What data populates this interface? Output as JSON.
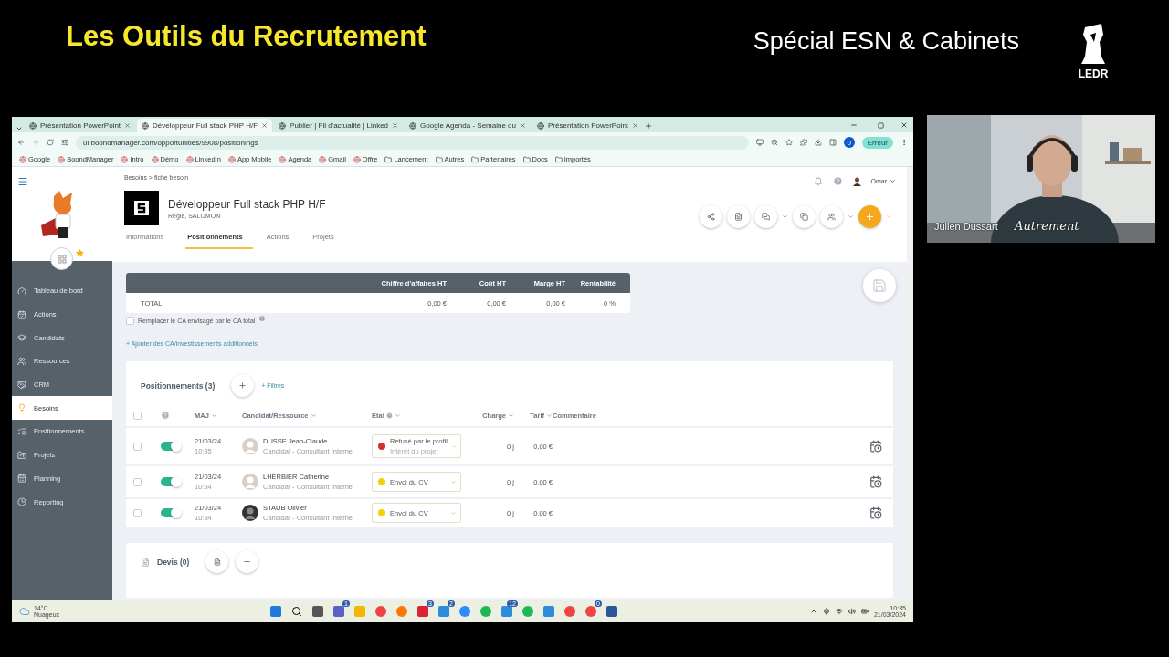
{
  "slide": {
    "title": "Les Outils du Recrutement",
    "subtitle": "Spécial ESN & Cabinets",
    "logo": "LEDR"
  },
  "browser": {
    "tabs": [
      {
        "label": "Présentation PowerPoint",
        "selected": false
      },
      {
        "label": "Développeur Full stack PHP H/F",
        "selected": true
      },
      {
        "label": "Publier | Fil d'actualité | Linked",
        "selected": false
      },
      {
        "label": "Google Agenda - Semaine du",
        "selected": false
      },
      {
        "label": "Présentation PowerPoint",
        "selected": false
      }
    ],
    "url": "ui.boondmanager.com/opportunities/9908/positionings",
    "profile": "0",
    "status_button": "Erreur",
    "bookmarks": [
      {
        "label": "Google",
        "kind": "link"
      },
      {
        "label": "BoondManager",
        "kind": "link"
      },
      {
        "label": "Intro",
        "kind": "link"
      },
      {
        "label": "Démo",
        "kind": "link"
      },
      {
        "label": "LinkedIn",
        "kind": "link"
      },
      {
        "label": "App Mobile",
        "kind": "link"
      },
      {
        "label": "Agenda",
        "kind": "link"
      },
      {
        "label": "Gmail",
        "kind": "link"
      },
      {
        "label": "Offre",
        "kind": "link"
      },
      {
        "label": "Lancement",
        "kind": "folder"
      },
      {
        "label": "Autres",
        "kind": "folder"
      },
      {
        "label": "Partenaires",
        "kind": "folder"
      },
      {
        "label": "Docs",
        "kind": "folder"
      },
      {
        "label": "Importés",
        "kind": "folder"
      }
    ]
  },
  "sidebar": {
    "items": [
      {
        "label": "Tableau de bord",
        "selected": false
      },
      {
        "label": "Actions",
        "selected": false
      },
      {
        "label": "Candidats",
        "selected": false
      },
      {
        "label": "Ressources",
        "selected": false
      },
      {
        "label": "CRM",
        "selected": false
      },
      {
        "label": "Besoins",
        "selected": true
      },
      {
        "label": "Positionnements",
        "selected": false
      },
      {
        "label": "Projets",
        "selected": false
      },
      {
        "label": "Planning",
        "selected": false
      },
      {
        "label": "Reporting",
        "selected": false
      }
    ]
  },
  "header": {
    "breadcrumb": "Besoins > fiche besoin",
    "title": "Développeur Full stack PHP H/F",
    "subtitle": "Régie, SALOMON",
    "user": "Omar",
    "tabs": [
      {
        "label": "Informations",
        "selected": false
      },
      {
        "label": "Positionnements",
        "selected": true
      },
      {
        "label": "Actions",
        "selected": false
      },
      {
        "label": "Projets",
        "selected": false
      }
    ]
  },
  "summary": {
    "columns": [
      "Chiffre d'affaires HT",
      "Coût HT",
      "Marge HT",
      "Rentabilité"
    ],
    "total_label": "TOTAL",
    "total": [
      "0,00 €",
      "0,00 €",
      "0,00 €",
      "0 %"
    ],
    "replace_option": {
      "label": "Remplacer le CA envisagé par le CA total",
      "checked": false
    },
    "add_link": "+ Ajouter des CA/investissements additionnels"
  },
  "positionings": {
    "title": "Positionnements (3)",
    "filters": "+ Filtres",
    "select_all_checked": false,
    "columns": [
      "MAJ",
      "Candidat/Ressource",
      "État",
      "Charge",
      "Tarif",
      "Commentaire"
    ],
    "rows": [
      {
        "date": "21/03/24",
        "time": "10:35",
        "name": "DUSSE Jean-Claude",
        "role": "Candidat - Consultant Interne",
        "status": "Refusé par le profil",
        "status_detail": "Intérêt du projet",
        "color": "#d32f2f",
        "charge": "0 j",
        "rate": "0,00 €",
        "on": true,
        "checked": false
      },
      {
        "date": "21/03/24",
        "time": "10:34",
        "name": "LHERBIER Catherine",
        "role": "Candidat - Consultant Interne",
        "status": "Envoi du CV",
        "color": "#f5cf0a",
        "charge": "0 j",
        "rate": "0,00 €",
        "on": true,
        "checked": false
      },
      {
        "date": "21/03/24",
        "time": "10:34",
        "name": "STAUB Olivier",
        "role": "Candidat - Consultant Interne",
        "status": "Envoi du CV",
        "color": "#f5cf0a",
        "charge": "0 j",
        "rate": "0,00 €",
        "on": true,
        "checked": false
      }
    ]
  },
  "quotes": {
    "title": "Devis (0)"
  },
  "taskbar": {
    "temperature": "14°C",
    "weather": "Nuageux",
    "time": "10:35",
    "date": "21/03/2024",
    "apps": [
      {
        "kind": "start"
      },
      {
        "kind": "search"
      },
      {
        "kind": "files"
      },
      {
        "kind": "teams",
        "badge": "1"
      },
      {
        "kind": "folder"
      },
      {
        "kind": "chrome"
      },
      {
        "kind": "firefox"
      },
      {
        "kind": "slack",
        "badge": "3"
      },
      {
        "kind": "app",
        "badge": "2"
      },
      {
        "kind": "zoom"
      },
      {
        "kind": "spotify"
      },
      {
        "kind": "app",
        "badge": "12"
      },
      {
        "kind": "spotify"
      },
      {
        "kind": "app"
      },
      {
        "kind": "chrome"
      },
      {
        "kind": "chrome",
        "badge": "0"
      },
      {
        "kind": "word"
      }
    ]
  },
  "webcam": {
    "name": "Julien Dussart",
    "caption": "Autrement"
  }
}
